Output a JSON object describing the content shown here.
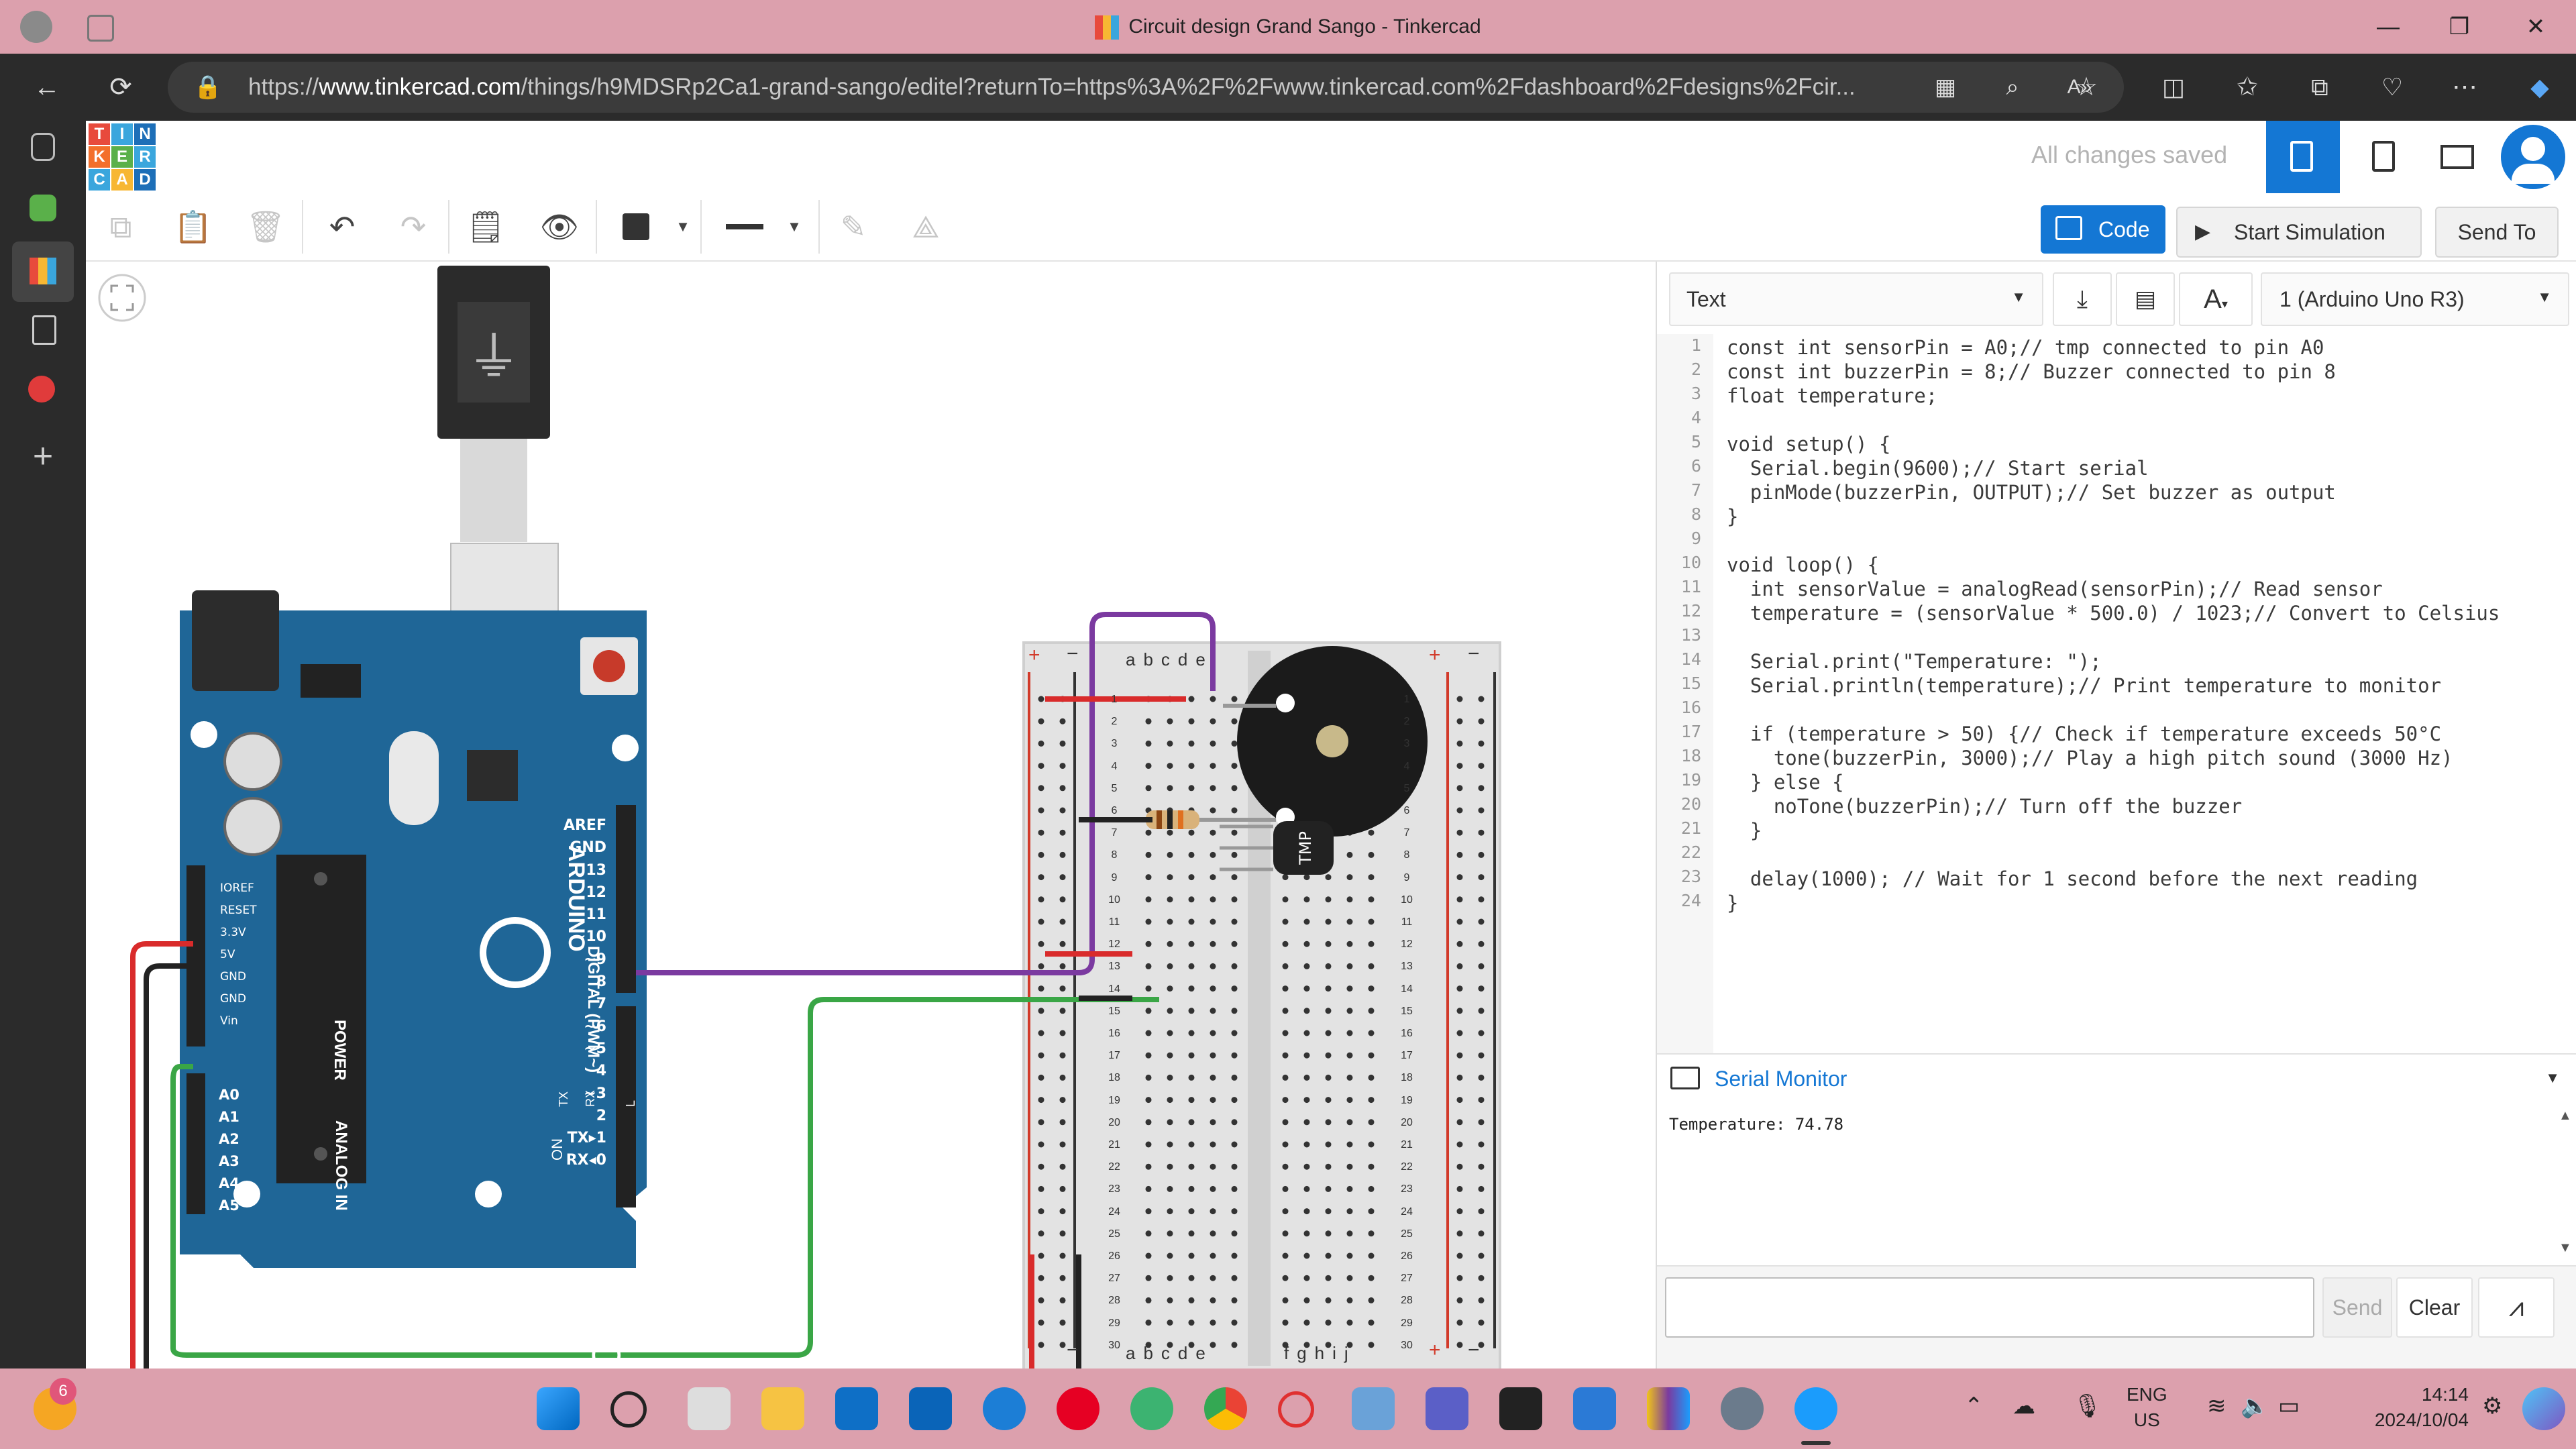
{
  "window": {
    "title": "Circuit design Grand Sango - Tinkercad",
    "minimize": "—",
    "maximize": "❐",
    "close": "✕"
  },
  "browser": {
    "url_host": "www.tinkercad.com",
    "url_prefix": "https://",
    "url_rest": "/things/h9MDSRp2Ca1-grand-sango/editel?returnTo=https%3A%2F%2Fwww.tinkercad.com%2Fdashboard%2Fdesigns%2Fcir..."
  },
  "app": {
    "logo_letters": [
      "T",
      "I",
      "N",
      "K",
      "E",
      "R",
      "C",
      "A",
      "D"
    ],
    "save_status": "All changes saved",
    "toolbar": {
      "code_label": "Code",
      "start_simulation_label": "Start Simulation",
      "send_to_label": "Send To"
    }
  },
  "code_panel": {
    "mode": "Text",
    "device": "1 (Arduino Uno R3)",
    "lines": [
      "const int sensorPin = A0;// tmp connected to pin A0",
      "const int buzzerPin = 8;// Buzzer connected to pin 8",
      "float temperature;",
      "",
      "void setup() {",
      "  Serial.begin(9600);// Start serial",
      "  pinMode(buzzerPin, OUTPUT);// Set buzzer as output",
      "}",
      "",
      "void loop() {",
      "  int sensorValue = analogRead(sensorPin);// Read sensor",
      "  temperature = (sensorValue * 500.0) / 1023;// Convert to Celsius",
      "",
      "  Serial.print(\"Temperature: \");",
      "  Serial.println(temperature);// Print temperature to monitor",
      "",
      "  if (temperature > 50) {// Check if temperature exceeds 50°C",
      "    tone(buzzerPin, 3000);// Play a high pitch sound (3000 Hz)",
      "  } else {",
      "    noTone(buzzerPin);// Turn off the buzzer",
      "  }",
      "",
      "  delay(1000); // Wait for 1 second before the next reading",
      "}"
    ],
    "line_numbers": [
      "1",
      "2",
      "3",
      "4",
      "5",
      "6",
      "7",
      "8",
      "9",
      "10",
      "11",
      "12",
      "13",
      "14",
      "15",
      "16",
      "17",
      "18",
      "19",
      "20",
      "21",
      "22",
      "23",
      "24"
    ],
    "serial_monitor": {
      "title": "Serial Monitor",
      "output": "Temperature: 74.78",
      "send_label": "Send",
      "clear_label": "Clear"
    }
  },
  "board": {
    "brand": "ARDUINO",
    "model": "UNO",
    "digital_label": "DIGITAL (PWM~)",
    "power_label": "POWER",
    "analog_label": "ANALOG IN",
    "on_label": "ON",
    "tx_label": "TX",
    "rx_label": "RX",
    "l_label": "L",
    "power_pins": [
      "IOREF",
      "RESET",
      "3.3V",
      "5V",
      "GND",
      "GND",
      "Vin"
    ],
    "analog_pins": [
      "A0",
      "A1",
      "A2",
      "A3",
      "A4",
      "A5"
    ],
    "digital_pins": [
      "AREF",
      "GND",
      "13",
      "12",
      "~11",
      "~10",
      "~9",
      "8",
      "7",
      "~6",
      "~5",
      "4",
      "~3",
      "2",
      "TX▸1",
      "RX◂0"
    ]
  },
  "breadboard": {
    "cols_left": [
      "a",
      "b",
      "c",
      "d",
      "e"
    ],
    "cols_right": [
      "f",
      "g",
      "h",
      "i",
      "j"
    ],
    "rows": [
      "1",
      "2",
      "3",
      "4",
      "5",
      "6",
      "7",
      "8",
      "9",
      "10",
      "11",
      "12",
      "13",
      "14",
      "15",
      "16",
      "17",
      "18",
      "19",
      "20",
      "21",
      "22",
      "23",
      "24",
      "25",
      "26",
      "27",
      "28",
      "29",
      "30"
    ],
    "plus": "+",
    "minus": "−"
  },
  "components": {
    "tmp_label": "TMP",
    "buzzer_plus": "+"
  },
  "taskbar": {
    "badge": "6",
    "lang": "ENG",
    "region": "US",
    "time": "14:14",
    "date": "2024/10/04"
  }
}
